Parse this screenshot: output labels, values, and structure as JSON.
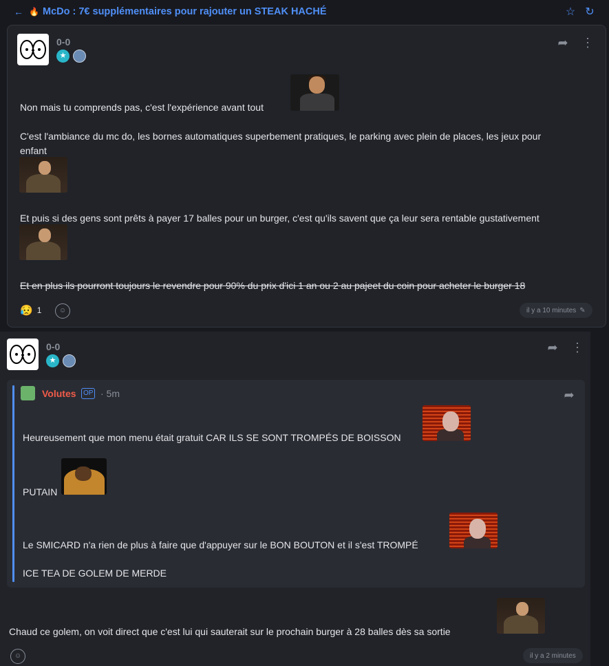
{
  "header": {
    "back_icon": "arrow-left-icon",
    "fire_icon": "fire-icon",
    "title": "McDo : 7€ supplémentaires pour rajouter un STEAK HACHÉ",
    "star_icon": "star-icon",
    "refresh_icon": "refresh-icon"
  },
  "post1": {
    "username": "0-0",
    "body": [
      "Non mais tu comprends pas, c'est l'expérience avant tout",
      "C'est l'ambiance du mc do, les bornes automatiques superbement pratiques, le parking avec plein de places, les jeux pour",
      "enfant",
      "Et puis si des gens sont prêts à payer 17 balles pour un burger, c'est qu'ils savent que ça leur sera rentable gustativement",
      "Et en plus ils pourront toujours le revendre pour 90% du prix d'ici 1 an ou 2 au pajeet du coin pour acheter le burger 18"
    ],
    "reaction_emoji": "😥",
    "reaction_count": "1",
    "timestamp": "il y a 10 minutes"
  },
  "post2": {
    "username": "0-0",
    "quote": {
      "author": "Volutes",
      "op_label": "OP",
      "time": "· 5m",
      "lines": [
        "Heureusement que mon menu était gratuit CAR ILS SE SONT TROMPÉS DE BOISSON",
        "PUTAIN",
        "Le SMICARD n'a rien de plus à faire que d'appuyer sur le BON BOUTON et il s'est TROMPÉ",
        "ICE TEA DE GOLEM DE MERDE"
      ]
    },
    "body": "Chaud ce golem, on voit direct que c'est lui qui sauterait sur le prochain burger à 28 balles dès sa sortie",
    "timestamp": "il y a 2 minutes"
  },
  "colors": {
    "accent": "#4f8ff7",
    "background": "#18191e",
    "card": "#212329",
    "op_author": "#f25c4a"
  }
}
